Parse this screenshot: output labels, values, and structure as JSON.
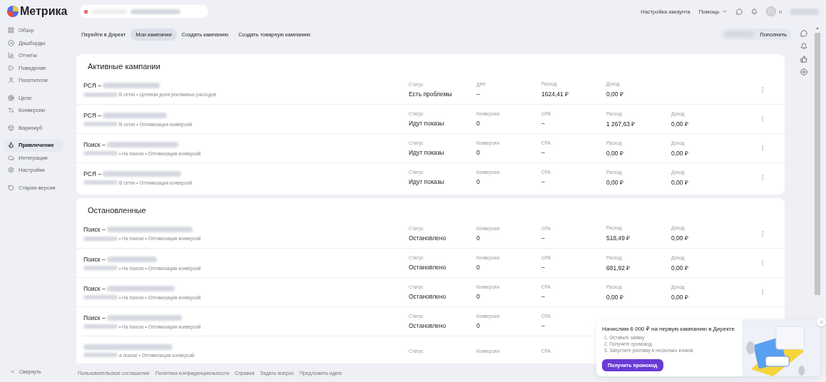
{
  "header": {
    "logo": "Метрика",
    "links": [
      "Настройка аккаунта",
      "Помощь"
    ],
    "user_initial": "п"
  },
  "sidebar": {
    "groups": [
      [
        {
          "label": "Обзор",
          "selected": false
        },
        {
          "label": "Дашборды",
          "selected": false
        },
        {
          "label": "Отчеты",
          "selected": false
        },
        {
          "label": "Поведение",
          "selected": false
        },
        {
          "label": "Посетители",
          "selected": false
        }
      ],
      [
        {
          "label": "Цели",
          "selected": false
        },
        {
          "label": "Конверсии",
          "selected": false
        }
      ],
      [
        {
          "label": "Вариокуб",
          "selected": false
        }
      ],
      [
        {
          "label": "Привлечение",
          "selected": true
        },
        {
          "label": "Интеграции",
          "selected": false
        },
        {
          "label": "Настройки",
          "selected": false
        }
      ],
      [
        {
          "label": "Старая версия",
          "selected": false
        }
      ]
    ],
    "collapse": "Свернуть"
  },
  "tabs": [
    {
      "label": "Перейти в Директ",
      "selected": false
    },
    {
      "label": "Мои кампании",
      "selected": true
    },
    {
      "label": "Создать кампанию",
      "selected": false
    },
    {
      "label": "Создать товарную кампанию",
      "selected": false
    }
  ],
  "top_up": "Пополнить",
  "sections": [
    {
      "title": "Активные кампании",
      "campaigns": [
        {
          "prefix": "РСЯ –",
          "subtitle": "В сетях • Целевая доля рекламных расходов",
          "menu": true,
          "metrics": [
            {
              "label": "Статус",
              "value": "Есть проблемы"
            },
            {
              "label": "ДРР",
              "value": "–"
            },
            {
              "label": "Расход",
              "value": "1624,41 ₽"
            },
            {
              "label": "Доход",
              "value": "0,00 ₽"
            }
          ]
        },
        {
          "prefix": "РСЯ –",
          "subtitle": "В сетях • Оптимизация конверсий",
          "menu": true,
          "metrics": [
            {
              "label": "Статус",
              "value": "Идут показы"
            },
            {
              "label": "Конверсии",
              "value": "0"
            },
            {
              "label": "CPA",
              "value": "–"
            },
            {
              "label": "Расход",
              "value": "1 267,63 ₽"
            },
            {
              "label": "Доход",
              "value": "0,00 ₽"
            }
          ]
        },
        {
          "prefix": "Поиск –",
          "subtitle": "• На поиске • Оптимизация конверсий",
          "menu": true,
          "metrics": [
            {
              "label": "Статус",
              "value": "Идут показы"
            },
            {
              "label": "Конверсии",
              "value": "0"
            },
            {
              "label": "CPA",
              "value": "–"
            },
            {
              "label": "Расход",
              "value": "0,00 ₽"
            },
            {
              "label": "Доход",
              "value": "0,00 ₽"
            }
          ]
        },
        {
          "prefix": "РСЯ –",
          "subtitle": "В сетях • Оптимизация конверсий",
          "menu": true,
          "metrics": [
            {
              "label": "Статус",
              "value": "Идут показы"
            },
            {
              "label": "Конверсии",
              "value": "0"
            },
            {
              "label": "CPA",
              "value": "–"
            },
            {
              "label": "Расход",
              "value": "0,00 ₽"
            },
            {
              "label": "Доход",
              "value": "0,00 ₽"
            }
          ]
        }
      ]
    },
    {
      "title": "Остановленные",
      "campaigns": [
        {
          "prefix": "Поиск –",
          "subtitle": "• На поиске • Оптимизация конверсий",
          "menu": true,
          "metrics": [
            {
              "label": "Статус",
              "value": "Остановлено"
            },
            {
              "label": "Конверсии",
              "value": "0"
            },
            {
              "label": "CPA",
              "value": "–"
            },
            {
              "label": "Расход",
              "value": "518,49 ₽"
            },
            {
              "label": "Доход",
              "value": "0,00 ₽"
            }
          ]
        },
        {
          "prefix": "Поиск –",
          "subtitle": "• На поиске • Оптимизация конверсий",
          "menu": true,
          "metrics": [
            {
              "label": "Статус",
              "value": "Остановлено"
            },
            {
              "label": "Конверсии",
              "value": "0"
            },
            {
              "label": "CPA",
              "value": "–"
            },
            {
              "label": "Расход",
              "value": "681,92 ₽"
            },
            {
              "label": "Доход",
              "value": "0,00 ₽"
            }
          ]
        },
        {
          "prefix": "Поиск –",
          "subtitle": "• На поиске • Оптимизация конверсий",
          "menu": true,
          "metrics": [
            {
              "label": "Статус",
              "value": "Остановлено"
            },
            {
              "label": "Конверсии",
              "value": "0"
            },
            {
              "label": "CPA",
              "value": "–"
            },
            {
              "label": "Расход",
              "value": "0,00 ₽"
            },
            {
              "label": "Доход",
              "value": "0,00 ₽"
            }
          ]
        },
        {
          "prefix": "Поиск –",
          "subtitle": "• На поиске • Оптимизация конверсий",
          "menu": false,
          "metrics": [
            {
              "label": "Статус",
              "value": "Остановлено"
            },
            {
              "label": "Конверсии",
              "value": "0"
            },
            {
              "label": "CPA",
              "value": "–"
            }
          ]
        },
        {
          "subtitle": "а поиске • Оптимизация конверсий",
          "menu": false,
          "metrics": [
            {
              "label": "Статус"
            },
            {
              "label": "Конверсии"
            },
            {
              "label": "CPA"
            }
          ]
        }
      ]
    }
  ],
  "footer_links": [
    "Пользовательское соглашение",
    "Политика конфиденциальности",
    "Справка",
    "Задать вопрос",
    "Предложить идею"
  ],
  "promo": {
    "title": "Начислим 6 000 ₽ на первую кампанию в Директе",
    "steps": [
      "1. Оставьте заявку",
      "2. Получите промокод",
      "3. Запустите рекламу в несколько кликов"
    ],
    "button": "Получить промокод"
  }
}
